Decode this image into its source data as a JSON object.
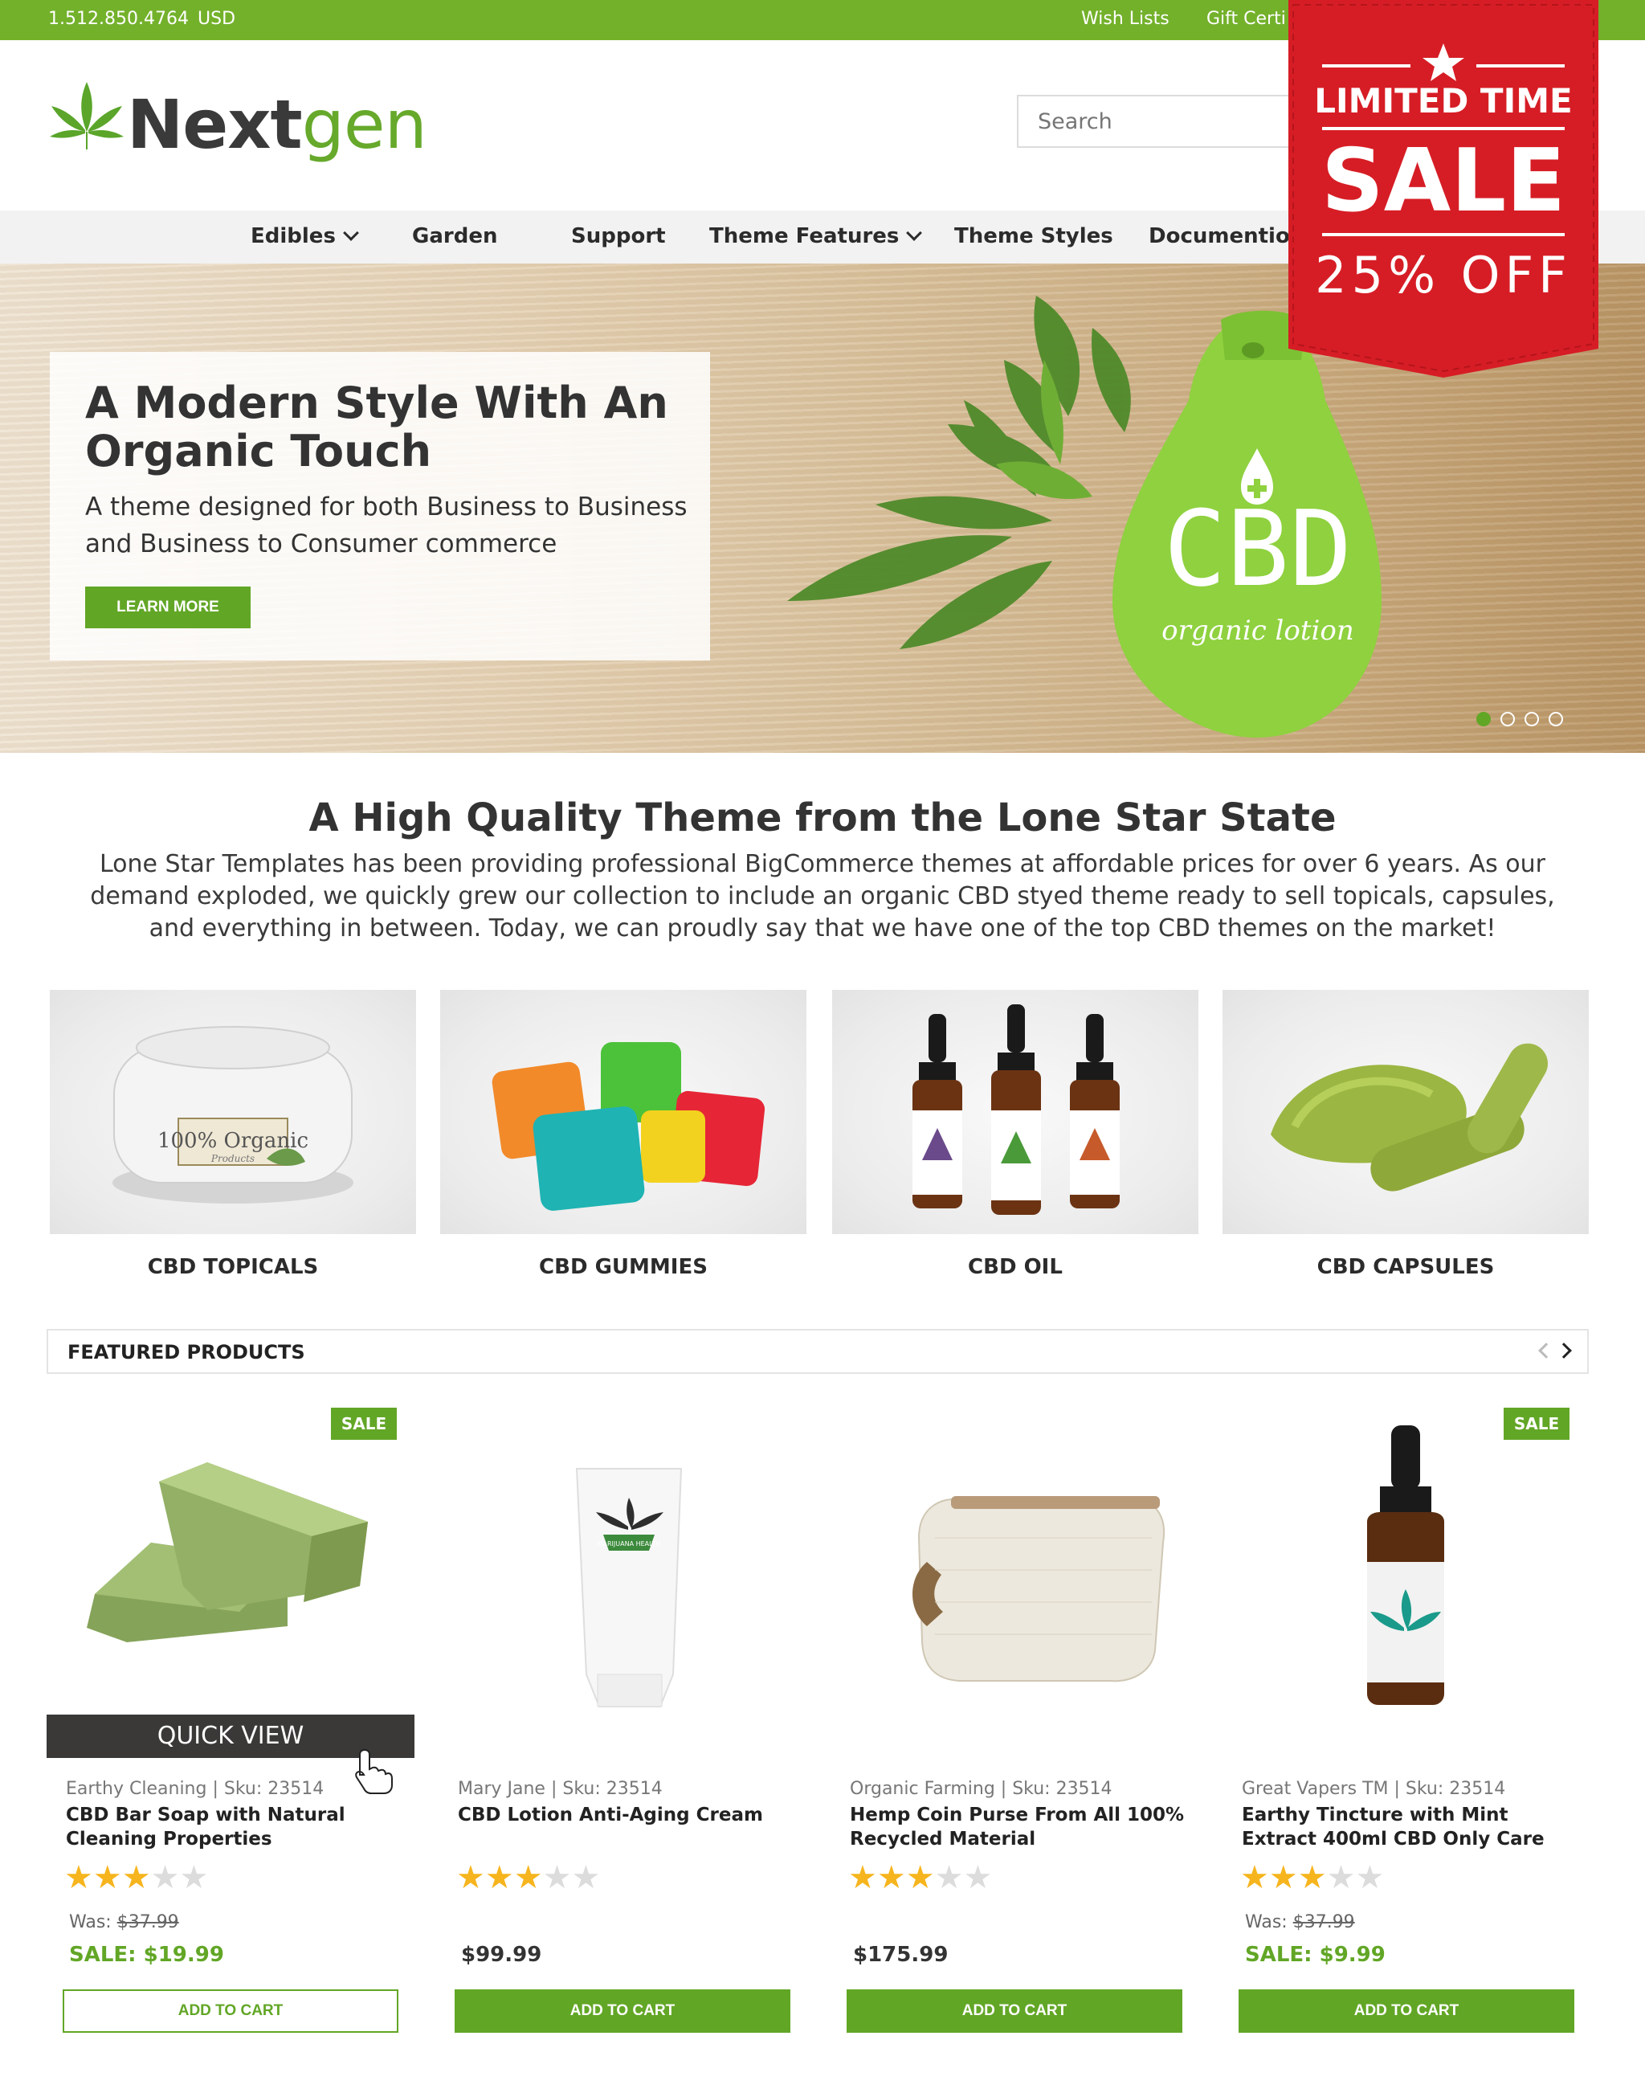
{
  "topbar": {
    "phone": "1.512.850.4764",
    "currency": "USD",
    "wish_lists": "Wish Lists",
    "gift_certificates": "Gift Certi"
  },
  "header": {
    "logo_next": "Next",
    "logo_gen": "gen",
    "search_placeholder": "Search"
  },
  "nav": {
    "items": [
      {
        "label": "Edibles",
        "dropdown": true
      },
      {
        "label": "Garden",
        "dropdown": false
      },
      {
        "label": "Support",
        "dropdown": false
      },
      {
        "label": "Theme Features",
        "dropdown": true
      },
      {
        "label": "Theme Styles",
        "dropdown": false
      },
      {
        "label": "Documention",
        "dropdown": false
      }
    ]
  },
  "ribbon": {
    "line1": "LIMITED TIME",
    "line2": "SALE",
    "line3": "25% OFF",
    "color": "#d61d25"
  },
  "hero": {
    "title": "A Modern Style With An Organic Touch",
    "subtitle": "A theme designed for both Business to Business and Business to Consumer commerce",
    "button": "LEARN MORE",
    "bottle_text": "CBD",
    "bottle_script": "organic lotion",
    "slides": 4,
    "active_slide": 1
  },
  "about": {
    "title": "A High Quality Theme from the Lone Star State",
    "text": "Lone Star Templates has been providing professional BigCommerce themes at affordable prices for over 6 years. As our demand exploded, we quickly grew our collection to include an organic CBD styed theme ready to sell topicals, capsules, and everything in between. Today, we can proudly say that we have one of the top CBD themes on the market!"
  },
  "categories": [
    {
      "label": "CBD TOPICALS",
      "jar_text": "100% Organic",
      "jar_small": "Products"
    },
    {
      "label": "CBD GUMMIES"
    },
    {
      "label": "CBD OIL"
    },
    {
      "label": "CBD CAPSULES"
    }
  ],
  "featured": {
    "title": "FEATURED PRODUCTS"
  },
  "products": [
    {
      "brand": "Earthy Cleaning  |  Sku: 23514",
      "name": "CBD Bar Soap  with Natural Cleaning Properties",
      "rating": 3,
      "was_label": "Was:",
      "was": "$37.99",
      "price": "SALE: $19.99",
      "sale": true,
      "badge": "SALE",
      "button": "ADD TO CART",
      "quick_view": "QUICK VIEW",
      "tube_label": "MARIJUANA HEALTH"
    },
    {
      "brand": "Mary Jane  |  Sku: 23514",
      "name": "CBD Lotion Anti-Aging Cream",
      "rating": 3,
      "price": "$99.99",
      "sale": false,
      "button": "ADD TO CART",
      "tube_label": "MARIJUANA HEALTH"
    },
    {
      "brand": "Organic Farming  | Sku: 23514",
      "name": "Hemp Coin Purse From All 100% Recycled Material",
      "rating": 3,
      "price": "$175.99",
      "sale": false,
      "button": "ADD TO CART"
    },
    {
      "brand": "Great Vapers TM  | Sku: 23514",
      "name": "Earthy Tincture with Mint Extract 400ml CBD Only Care",
      "rating": 3,
      "was_label": "Was:",
      "was": "$37.99",
      "price": "SALE: $9.99",
      "sale": true,
      "badge": "SALE",
      "button": "ADD TO CART"
    }
  ],
  "colors": {
    "brand_green": "#73b12b",
    "button_green": "#62a626",
    "sale_red": "#d61d25",
    "star": "#f6b51e"
  }
}
